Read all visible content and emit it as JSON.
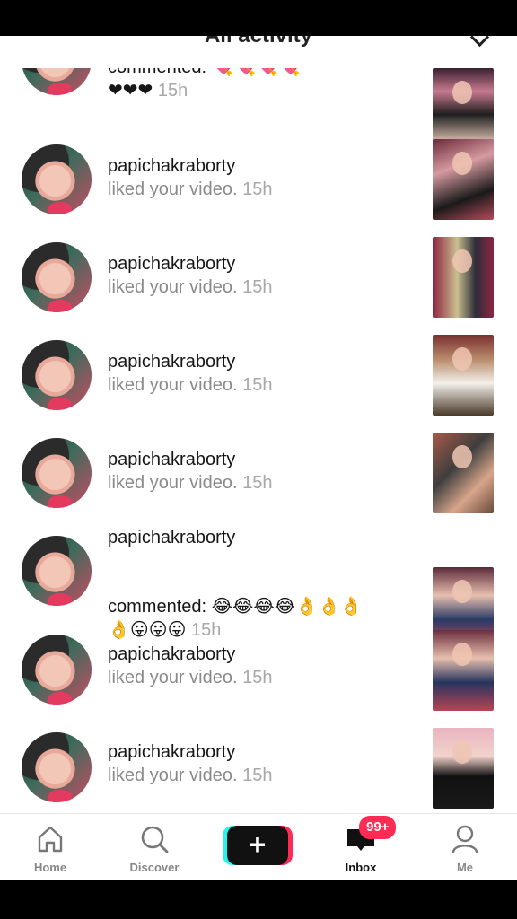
{
  "header": {
    "title": "All activity"
  },
  "rows": [
    {
      "username": "",
      "action": "commented: 💘💘💘💘",
      "action2": "❤❤❤",
      "time": "15h",
      "type": "comment"
    },
    {
      "username": "papichakraborty",
      "action": "liked your video.",
      "time": "15h",
      "type": "like"
    },
    {
      "username": "papichakraborty",
      "action": "liked your video.",
      "time": "15h",
      "type": "like"
    },
    {
      "username": "papichakraborty",
      "action": "liked your video.",
      "time": "15h",
      "type": "like"
    },
    {
      "username": "papichakraborty",
      "action": "liked your video.",
      "time": "15h",
      "type": "like"
    },
    {
      "username": "papichakraborty",
      "action": "commented: 😂😂😂😂👌👌👌",
      "action2": "👌😛😛😛",
      "time": "15h",
      "type": "comment"
    },
    {
      "username": "papichakraborty",
      "action": "liked your video.",
      "time": "15h",
      "type": "like"
    },
    {
      "username": "papichakraborty",
      "action": "liked your video.",
      "time": "15h",
      "type": "like"
    }
  ],
  "nav": {
    "home": "Home",
    "discover": "Discover",
    "create": "+",
    "inbox": "Inbox",
    "inbox_badge": "99+",
    "me": "Me"
  },
  "colors": {
    "accent": "#fe2c55",
    "cyan": "#25f4ee",
    "text": "#161616",
    "gray": "#8a8a8a"
  }
}
